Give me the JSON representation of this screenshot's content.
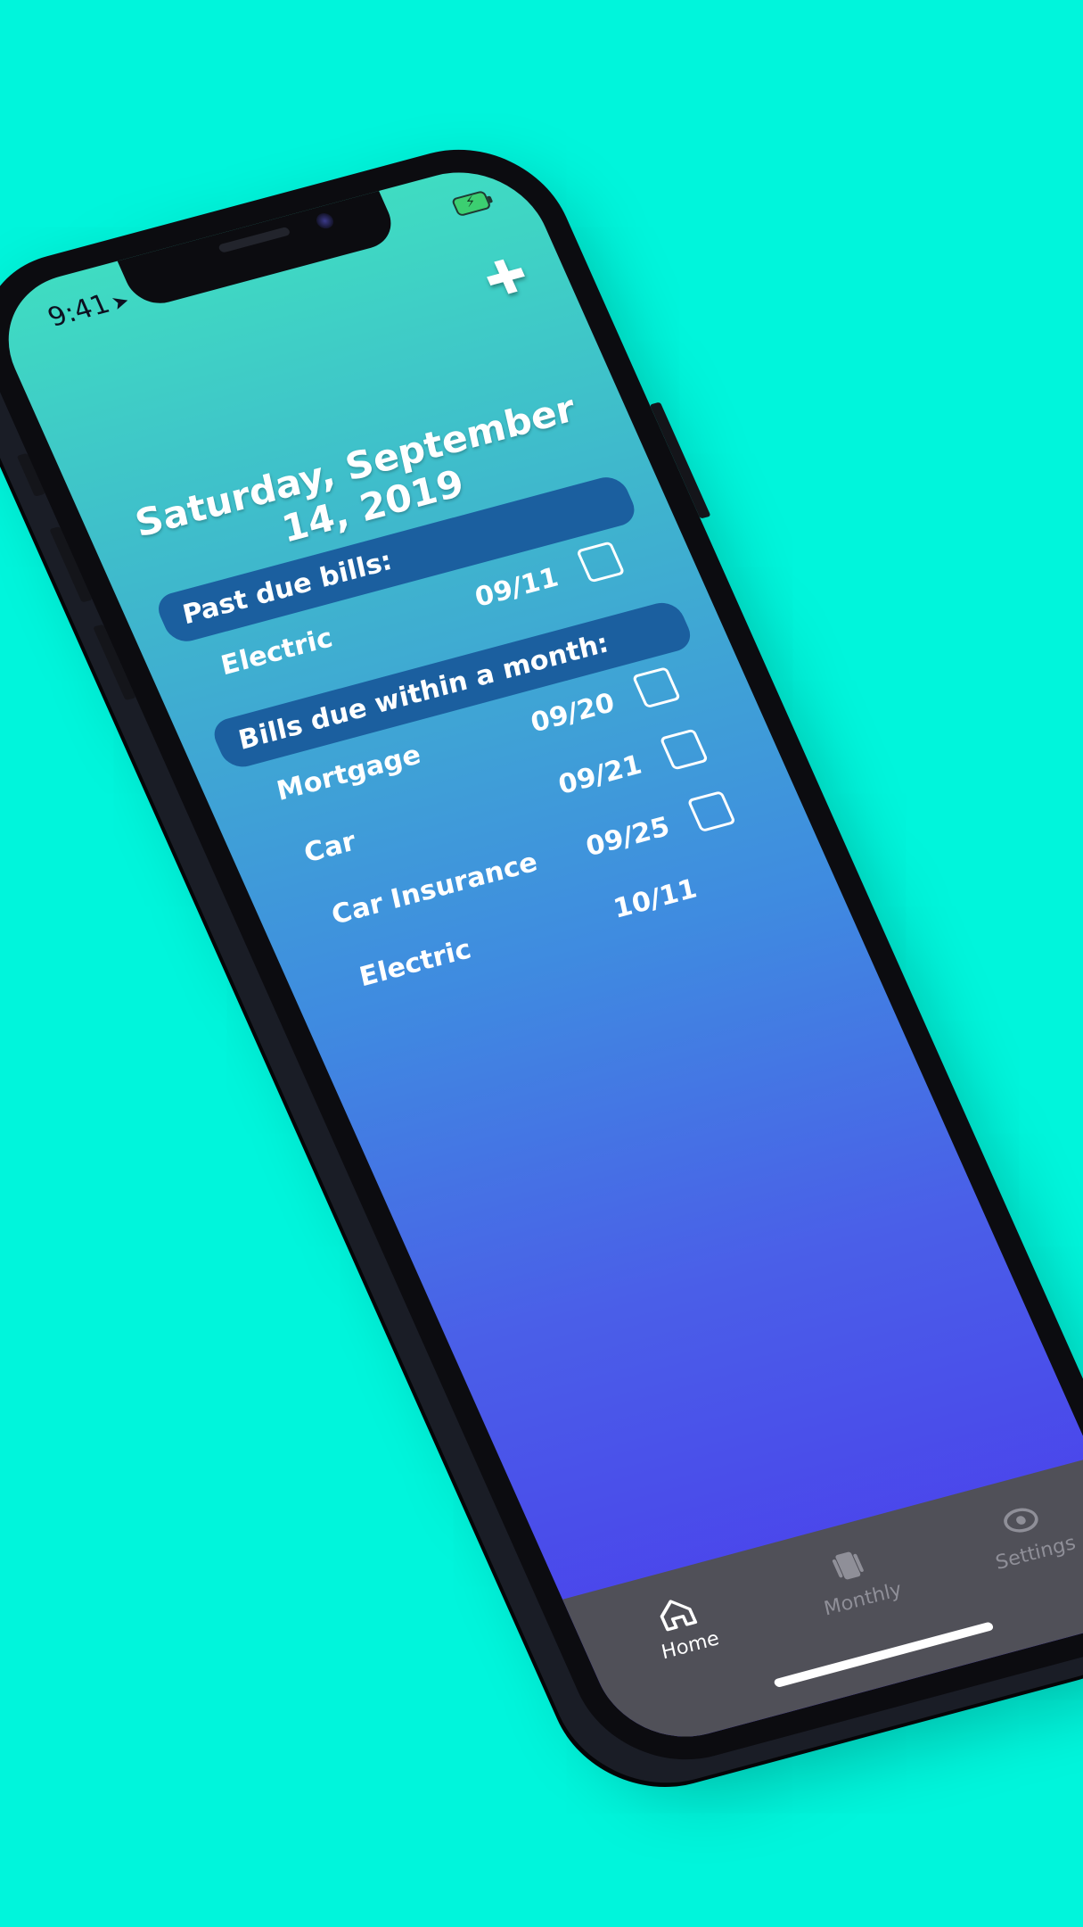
{
  "status_bar": {
    "time": "9:41",
    "location_glyph": "➤",
    "battery_icon": "battery-charging-icon"
  },
  "header": {
    "add_icon": "plus-icon",
    "add_glyph": "✚",
    "date": "Saturday, September 14, 2019"
  },
  "past_due": {
    "title": "Past due bills:",
    "items": [
      {
        "name": "Electric",
        "date": "09/11"
      }
    ]
  },
  "upcoming": {
    "title": "Bills due within a month:",
    "items": [
      {
        "name": "Mortgage",
        "date": "09/20"
      },
      {
        "name": "Car",
        "date": "09/21"
      },
      {
        "name": "Car Insurance",
        "date": "09/25"
      },
      {
        "name": "Electric",
        "date": "10/11"
      }
    ]
  },
  "tabbar": {
    "home": {
      "label": "Home",
      "icon": "home-icon"
    },
    "monthly": {
      "label": "Monthly",
      "icon": "cards-icon"
    },
    "settings": {
      "label": "Settings",
      "icon": "eye-icon"
    }
  },
  "colors": {
    "background": "#00f5dc",
    "gradient_top": "#3fdcc2",
    "gradient_bottom": "#4b3aed",
    "section_header": "#1b5f9f",
    "tabbar": "#505058"
  }
}
